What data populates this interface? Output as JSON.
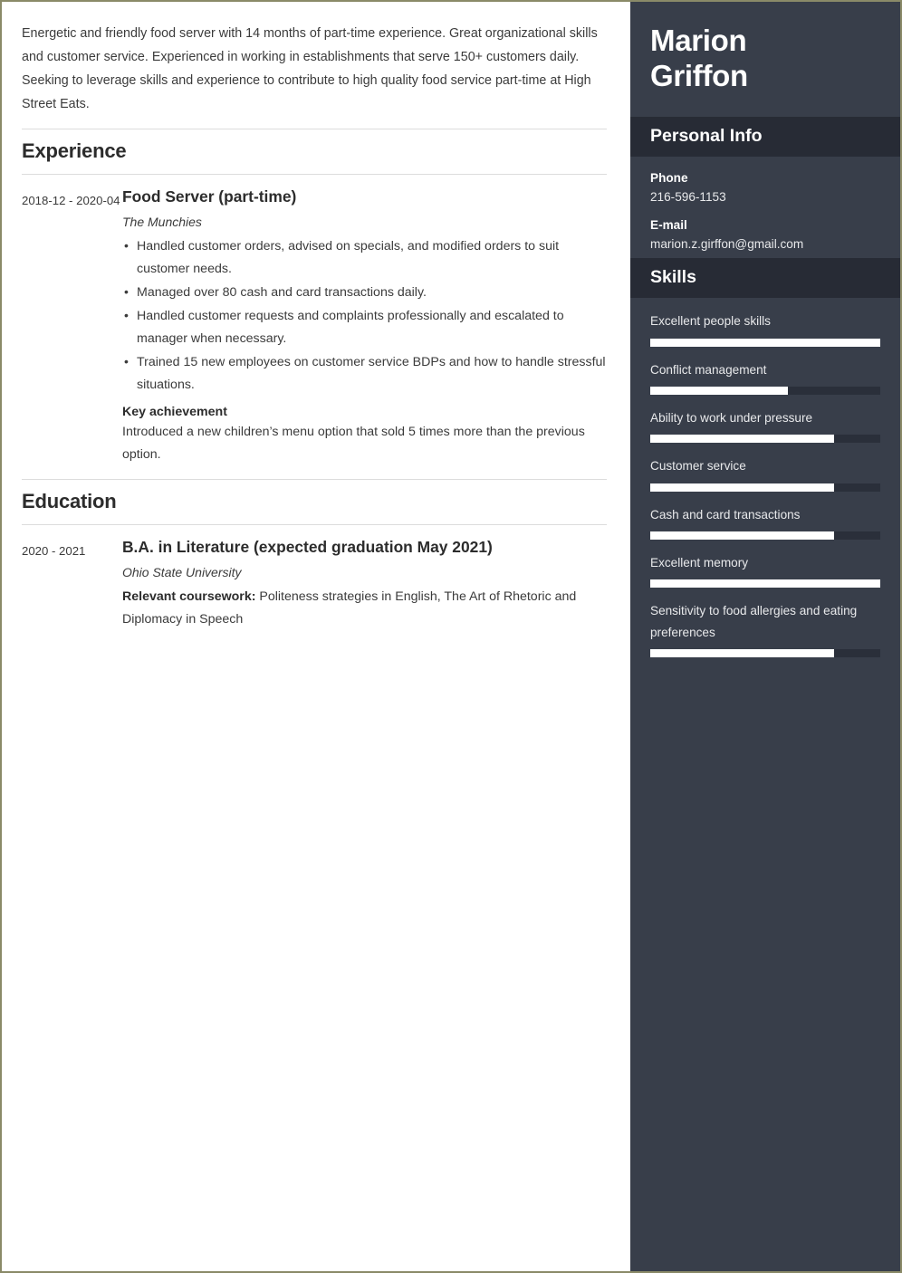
{
  "theme": {
    "page_border": "#8a8a68",
    "sidebar_bg": "#383e4a",
    "sidebar_header_bg": "#272b35",
    "skill_fill": "#ffffff",
    "skill_track": "#2a2f3a"
  },
  "main": {
    "summary": "Energetic and friendly food server with 14 months of part-time experience. Great organizational skills and customer service. Experienced in working in establishments that serve 150+ customers daily. Seeking to leverage skills and experience to contribute to high quality food service part-time at High Street Eats.",
    "sections": [
      {
        "title": "Experience",
        "entries": [
          {
            "dates": "2018-12 - 2020-04",
            "title": "Food Server (part-time)",
            "org": "The Munchies",
            "bullets": [
              "Handled customer orders, advised on specials, and modified orders to suit customer needs.",
              "Managed over 80 cash and card transactions daily.",
              "Handled customer requests and complaints professionally and escalated to manager when necessary.",
              "Trained 15 new employees on customer service BDPs and how to handle stressful situations."
            ],
            "achievement_label": "Key achievement",
            "achievement_text": "Introduced a new children’s menu option that sold 5 times more than the previous option."
          }
        ]
      },
      {
        "title": "Education",
        "entries": [
          {
            "dates": "2020 - 2021",
            "title": "B.A. in Literature (expected graduation May 2021)",
            "org": "Ohio State University",
            "coursework_label": "Relevant coursework:",
            "coursework_text": " Politeness strategies in English, The Art of Rhetoric and Diplomacy in Speech"
          }
        ]
      }
    ]
  },
  "sidebar": {
    "name_first": "Marion",
    "name_last": "Griffon",
    "personal_info": {
      "heading": "Personal Info",
      "phone_label": "Phone",
      "phone_value": "216-596-1153",
      "email_label": "E-mail",
      "email_value": "marion.z.girffon@gmail.com"
    },
    "skills": {
      "heading": "Skills",
      "items": [
        {
          "name": "Excellent people skills",
          "level": 100
        },
        {
          "name": "Conflict management",
          "level": 60
        },
        {
          "name": "Ability to work under pressure",
          "level": 80
        },
        {
          "name": "Customer service",
          "level": 80
        },
        {
          "name": "Cash and card transactions",
          "level": 80
        },
        {
          "name": "Excellent memory",
          "level": 100
        },
        {
          "name": "Sensitivity to food allergies and eating preferences",
          "level": 80
        }
      ]
    }
  }
}
